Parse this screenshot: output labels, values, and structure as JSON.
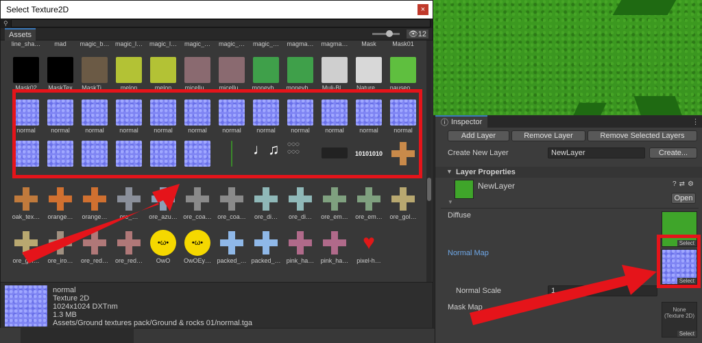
{
  "picker": {
    "title": "Select Texture2D",
    "close_icon": "×",
    "assets_tab": "Assets",
    "icon_count": "12",
    "rows": [
      {
        "tiles": [
          {
            "label": "line_sha…"
          },
          {
            "label": "mad"
          },
          {
            "label": "magic_b…"
          },
          {
            "label": "magic_l…"
          },
          {
            "label": "magic_l…"
          },
          {
            "label": "magic_…"
          },
          {
            "label": "magic_…"
          },
          {
            "label": "magic_…"
          },
          {
            "label": "magma…"
          },
          {
            "label": "magma…"
          },
          {
            "label": "Mask"
          },
          {
            "label": "Mask01"
          }
        ]
      },
      {
        "tiles": [
          {
            "label": "Mask02",
            "color": "#000000"
          },
          {
            "label": "MaskTex",
            "color": "#000000"
          },
          {
            "label": "MaskTi…",
            "color": "#6b5a45"
          },
          {
            "label": "melon",
            "color": "#b3c235"
          },
          {
            "label": "melon",
            "color": "#b3c235"
          },
          {
            "label": "micellu…",
            "color": "#8a6a70"
          },
          {
            "label": "micellu…",
            "color": "#8a6a70"
          },
          {
            "label": "moneyb…",
            "color": "#3fa04a"
          },
          {
            "label": "moneyb…",
            "color": "#3fa04a"
          },
          {
            "label": "Muli-Bl…",
            "color": "#cfcfcf"
          },
          {
            "label": "Nature…",
            "color": "#d8d8d8"
          },
          {
            "label": "nauseo…",
            "color": "#5fbf3f"
          }
        ]
      },
      {
        "tiles": [
          {
            "label": "normal"
          },
          {
            "label": "normal"
          },
          {
            "label": "normal"
          },
          {
            "label": "normal"
          },
          {
            "label": "normal"
          },
          {
            "label": "normal"
          },
          {
            "label": "normal"
          },
          {
            "label": "normal"
          },
          {
            "label": "normal"
          },
          {
            "label": "normal"
          },
          {
            "label": "normal"
          },
          {
            "label": "normal"
          }
        ]
      },
      {
        "tiles": [
          {
            "kind": "nmap"
          },
          {
            "kind": "nmap"
          },
          {
            "kind": "nmap"
          },
          {
            "kind": "nmap"
          },
          {
            "kind": "nmap"
          },
          {
            "kind": "nmap"
          },
          {
            "kind": "line"
          },
          {
            "kind": "notes"
          },
          {
            "kind": "circles"
          },
          {
            "kind": "dots"
          },
          {
            "kind": "binary",
            "text": "10101010"
          },
          {
            "kind": "cross",
            "color": "#c98a4a"
          }
        ]
      },
      {
        "tiles": [
          {
            "label": "oak_tex…",
            "color": "#c07a3c"
          },
          {
            "label": "orange…",
            "color": "#d07030"
          },
          {
            "label": "orange…",
            "color": "#d07030"
          },
          {
            "label": "ore_…",
            "color": "#8a8f9a"
          },
          {
            "label": "ore_azu…",
            "color": "#8aa0b8"
          },
          {
            "label": "ore_coa…",
            "color": "#8a8a8a"
          },
          {
            "label": "ore_coa…",
            "color": "#8a8a8a"
          },
          {
            "label": "ore_di…",
            "color": "#8fb8b8"
          },
          {
            "label": "ore_di…",
            "color": "#8fb8b8"
          },
          {
            "label": "ore_em…",
            "color": "#7fa07f"
          },
          {
            "label": "ore_em…",
            "color": "#7fa07f"
          },
          {
            "label": "ore_gol…",
            "color": "#b8a870"
          }
        ]
      },
      {
        "tiles": [
          {
            "label": "ore_gol…",
            "color": "#b8a870"
          },
          {
            "label": "ore_iro…",
            "color": "#a09080"
          },
          {
            "label": "ore_red…",
            "color": "#b07878"
          },
          {
            "label": "ore_red…",
            "color": "#b07878"
          },
          {
            "label": "OwO",
            "color": "#f5d800",
            "kind": "face"
          },
          {
            "label": "OwOEy…",
            "color": "#f5d800",
            "kind": "face"
          },
          {
            "label": "packed_…",
            "color": "#8fb8e8"
          },
          {
            "label": "packed_…",
            "color": "#8fb8e8"
          },
          {
            "label": "pink_ha…",
            "color": "#b06a8a"
          },
          {
            "label": "pink_ha…",
            "color": "#b06a8a"
          },
          {
            "label": "pixel-h…",
            "color": "#e01818",
            "kind": "heart"
          }
        ]
      }
    ],
    "details": {
      "name": "normal",
      "type": "Texture 2D",
      "size": "1024x1024  DXTnm",
      "filesize": "1.3 MB",
      "path": "Assets/Ground textures pack/Ground & rocks 01/normal.tga"
    }
  },
  "inspector": {
    "tab_label": "Inspector",
    "add_layer": "Add Layer",
    "remove_layer": "Remove Layer",
    "remove_selected": "Remove Selected Layers",
    "create_new_label": "Create New Layer",
    "new_layer_value": "NewLayer",
    "create_button": "Create...",
    "layer_props_label": "Layer Properties",
    "layer_name": "NewLayer",
    "open_button": "Open",
    "diffuse_label": "Diffuse",
    "diffuse_color": "#3fa52a",
    "select_label": "Select",
    "normal_map_label": "Normal Map",
    "normal_scale_label": "Normal Scale",
    "normal_scale_value": "1",
    "mask_map_label": "Mask Map",
    "mask_none": "None\n(Texture 2D)"
  },
  "colors": {
    "highlight": "#e5141a",
    "normal_blue": "#7f85f3",
    "accent": "#3a79bb"
  }
}
